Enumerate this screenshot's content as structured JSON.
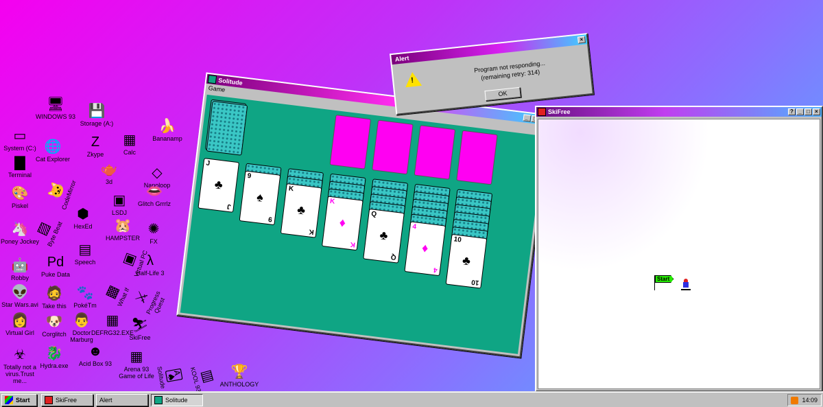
{
  "desktop_icons": [
    {
      "label": "WINDOWS 93",
      "icon": "computer-icon",
      "glyph": "🖥"
    },
    {
      "label": "Storage (A:)",
      "icon": "floppy-drive-icon",
      "glyph": "💾"
    },
    {
      "label": "Cat Explorer",
      "icon": "globe-icon",
      "glyph": "🌐"
    },
    {
      "label": "Zkype",
      "icon": "zkype-icon",
      "glyph": "Z"
    },
    {
      "label": "Calc",
      "icon": "calculator-icon",
      "glyph": "▦"
    },
    {
      "label": "Bananamp",
      "icon": "banana-icon",
      "glyph": "🍌"
    },
    {
      "label": "System (C:)",
      "icon": "hard-drive-icon",
      "glyph": "▭"
    },
    {
      "label": "Terminal",
      "icon": "terminal-icon",
      "glyph": "▇"
    },
    {
      "label": "3d",
      "icon": "teapot-icon",
      "glyph": "🫖"
    },
    {
      "label": "Nanoloop",
      "icon": "nanoloop-icon",
      "glyph": "◇"
    },
    {
      "label": "CodeMirror",
      "icon": "cat-icon",
      "glyph": "🐱"
    },
    {
      "label": "Piskel",
      "icon": "palette-icon",
      "glyph": "🎨"
    },
    {
      "label": "LSDJ",
      "icon": "lsdj-icon",
      "glyph": "▣"
    },
    {
      "label": "Glitch Grrrlz",
      "icon": "lips-icon",
      "glyph": "👄"
    },
    {
      "label": "Byte Beat",
      "icon": "bytebeat-icon",
      "glyph": "▨"
    },
    {
      "label": "HexEd",
      "icon": "cube-icon",
      "glyph": "⬢"
    },
    {
      "label": "Poney Jockey",
      "icon": "pony-icon",
      "glyph": "🦄"
    },
    {
      "label": "HAMPSTER",
      "icon": "hamster-icon",
      "glyph": "🐹"
    },
    {
      "label": "FX",
      "icon": "fx-icon",
      "glyph": "✺"
    },
    {
      "label": "Speech",
      "icon": "speech-icon",
      "glyph": "▤"
    },
    {
      "label": "Virtual PC",
      "icon": "virtual-pc-icon",
      "glyph": "▣"
    },
    {
      "label": "Robby",
      "icon": "robot-icon",
      "glyph": "🤖"
    },
    {
      "label": "Puke Data",
      "icon": "puke-data-icon",
      "glyph": "Pd"
    },
    {
      "label": "Half-Life 3",
      "icon": "lambda-icon",
      "glyph": "λ"
    },
    {
      "label": "Star Wars.avi",
      "icon": "yoda-icon",
      "glyph": "👽"
    },
    {
      "label": "Take this",
      "icon": "old-man-icon",
      "glyph": "🧔"
    },
    {
      "label": "PokéTm",
      "icon": "poke-icon",
      "glyph": "🐾"
    },
    {
      "label": "What If",
      "icon": "whatif-icon",
      "glyph": "▩"
    },
    {
      "label": "Progress Quest",
      "icon": "progress-quest-icon",
      "glyph": "⚔"
    },
    {
      "label": "Virtual Girl",
      "icon": "virtual-girl-icon",
      "glyph": "👩"
    },
    {
      "label": "Corglitch",
      "icon": "corgi-icon",
      "glyph": "🐶"
    },
    {
      "label": "Doctor Marburg",
      "icon": "doctor-icon",
      "glyph": "👨"
    },
    {
      "label": "DEFRG32.EXE",
      "icon": "defrag-icon",
      "glyph": "▦"
    },
    {
      "label": "SkiFree",
      "icon": "skifree-icon",
      "glyph": "⛷"
    },
    {
      "label": "Totally not a virus.Trust me...",
      "icon": "virus-icon",
      "glyph": "☣"
    },
    {
      "label": "Hydra.exe",
      "icon": "hydra-icon",
      "glyph": "🐉"
    },
    {
      "label": "Acid Box 93",
      "icon": "smiley-icon",
      "glyph": "☻"
    },
    {
      "label": "Arena 93 Game of Life",
      "icon": "arena-icon",
      "glyph": "▦"
    },
    {
      "label": "Solitude",
      "icon": "solitude-icon",
      "glyph": "🂡"
    },
    {
      "label": "KOOL 93",
      "icon": "kool-icon",
      "glyph": "▥"
    },
    {
      "label": "ANTHOLOGY",
      "icon": "trophy-icon",
      "glyph": "🏆"
    }
  ],
  "solitaire": {
    "title": "Solitude",
    "menu": "Game",
    "tableau": [
      {
        "rank": "J",
        "suit": "♣",
        "color": "#000000"
      },
      {
        "rank": "9",
        "suit": "♠",
        "color": "#000000"
      },
      {
        "rank": "K",
        "suit": "♣",
        "color": "#000000"
      },
      {
        "rank": "K",
        "suit": "♦",
        "color": "#ff00f2"
      },
      {
        "rank": "Q",
        "suit": "♣",
        "color": "#000000"
      },
      {
        "rank": "4",
        "suit": "♦",
        "color": "#ff00f2"
      },
      {
        "rank": "10",
        "suit": "♣",
        "color": "#000000"
      }
    ]
  },
  "alert": {
    "title": "Alert",
    "message_line1": "Program not responding...",
    "message_line2": "(remaining retry: 314)",
    "ok_label": "OK"
  },
  "skifree": {
    "title": "SkiFree",
    "flag_label": "Start"
  },
  "taskbar": {
    "start_label": "Start",
    "tasks": [
      "SkiFree",
      "Alert",
      "Solitude"
    ],
    "active_task": "Solitude",
    "clock": "14:09"
  },
  "colors": {
    "felt": "#0fa584",
    "foundation": "#ff00f2",
    "card_back": "#3ac7c5",
    "flag": "#26ea00"
  }
}
